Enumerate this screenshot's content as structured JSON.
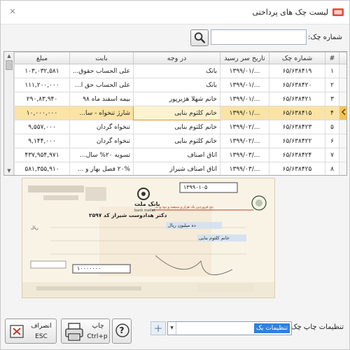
{
  "window": {
    "title": "لیست چک های پرداختی",
    "close_glyph": "✕"
  },
  "search": {
    "label": "شماره چک:",
    "value": "",
    "placeholder": ""
  },
  "table": {
    "columns": [
      "#",
      "شماره چک",
      "تاریخ سر رسید",
      "در وجه",
      "بابت",
      "مبلغ"
    ],
    "rows": [
      {
        "num": "۱",
        "check_no": "۶۵/۶۳۸۴۱۹",
        "date": "۱۳۹۹/۰۱/...",
        "payee": "بانک",
        "desc": "علی الحساب حقوق...",
        "amount": "۱۰۳,۰۳۲,۵۸۱"
      },
      {
        "num": "۲",
        "check_no": "۶۵/۶۳۸۴۲۰",
        "date": "۱۳۹۹/۰۱/...",
        "payee": "بانک",
        "desc": "علی الحساب حق ا...",
        "amount": "۱۱۱,۲۰۰,۰۰۰"
      },
      {
        "num": "۳",
        "check_no": "۶۵/۶۳۸۴۲۱",
        "date": "۱۳۹۹/۰۱/...",
        "payee": "خانم شهلا هژبرپور",
        "desc": "بیمه اسفند ماه ۹۸",
        "amount": "۲۹۰,۸۳,۹۴۰"
      },
      {
        "num": "۴",
        "check_no": "۶۵/۶۳۸۴۱۵",
        "date": "۱۳۹۹/۰۱/...",
        "payee": "خانم کلثوم بنایی",
        "desc": "شارژ تنخواه - سا...",
        "amount": "۱۰,۰۰۰,۰۰۰"
      },
      {
        "num": "۵",
        "check_no": "۶۵/۶۳۸۴۲۳",
        "date": "۱۳۹۹/۰۲/...",
        "payee": "خانم کلثوم بنایی",
        "desc": "تنخواه گردان",
        "amount": "۹,۵۵۷,۰۰۰"
      },
      {
        "num": "۶",
        "check_no": "۶۵/۶۳۸۴۲۲",
        "date": "۱۳۹۹/۰۲/...",
        "payee": "خانم کلثوم بنایی",
        "desc": "تنخواه گردان",
        "amount": "۹,۱۴۴,۰۰۰"
      },
      {
        "num": "۷",
        "check_no": "۶۵/۶۳۸۴۲۴",
        "date": "۱۳۹۹/۰۳/...",
        "payee": "اتاق اصناف",
        "desc": "تسویه ۲۰% سال...",
        "amount": "۴۳۷,۹۵۴,۹۷۱"
      },
      {
        "num": "۸",
        "check_no": "۶۵/۶۳۸۴۲۵",
        "date": "۱۳۹۹/۰۳/...",
        "payee": "اتاق اصناف شیراز",
        "desc": "۲۰% فصل بهار و ...",
        "amount": "۵۸۱,۳۵۵,۹۱۰"
      }
    ],
    "selected_index": 3
  },
  "cheque": {
    "bank_name": "بانک ملت",
    "bank_name_en": "bank mellat",
    "serial": "۱۳۹۹۰۱۰۵",
    "branch": "دکتر هدادوست شیراز کد ۲۵۹۷",
    "account_holder": "خانم کلثوم بنایی",
    "amount_words": "ده میلیون ریال",
    "amount_digits": "۱۰۰۰۰۰۰۰",
    "currency": "ریال",
    "warning": "پنج فروردین یک هزار و سیصد و نود و نه"
  },
  "bottom": {
    "settings_label": "تنظیمات چاپ چک:",
    "settings_value": "تنظیمات یک",
    "add_glyph": "+",
    "help_glyph": "?",
    "print_label": "چاپ",
    "print_shortcut": "Ctrl+p",
    "exit_label": "انصراف",
    "exit_shortcut": "ESC"
  },
  "colors": {
    "accent": "#2f80e0",
    "selected_row": "#fbe3a6",
    "selected_border": "#e3932b",
    "cheque_bg": "#f9f3e6"
  }
}
